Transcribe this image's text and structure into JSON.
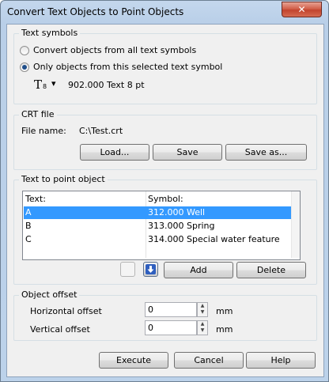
{
  "window": {
    "title": "Convert Text Objects to Point Objects",
    "close_glyph": "✕"
  },
  "text_symbols": {
    "group_label": "Text symbols",
    "option_all": "Convert objects from all text symbols",
    "option_selected": "Only objects from this selected text symbol",
    "selected_option": "option_selected",
    "symbol_icon": "T",
    "symbol_icon_sub": "8",
    "symbol_dropdown_arrow": "▾",
    "symbol_name": "902.000 Text 8 pt"
  },
  "crt_file": {
    "group_label": "CRT file",
    "file_name_label": "File name:",
    "file_name_value": "C:\\Test.crt",
    "load_button": "Load...",
    "save_button": "Save",
    "save_as_button": "Save as..."
  },
  "text_to_point": {
    "group_label": "Text to point object",
    "columns": {
      "text": "Text:",
      "symbol": "Symbol:"
    },
    "rows": [
      {
        "text": "A",
        "symbol": "312.000 Well",
        "selected": true
      },
      {
        "text": "B",
        "symbol": "313.000 Spring",
        "selected": false
      },
      {
        "text": "C",
        "symbol": "314.000 Special water feature",
        "selected": false
      }
    ],
    "add_button": "Add",
    "delete_button": "Delete",
    "move_down_icon": "arrow-down-icon"
  },
  "object_offset": {
    "group_label": "Object offset",
    "horizontal_label": "Horizontal offset",
    "horizontal_value": "0",
    "vertical_label": "Vertical offset",
    "vertical_value": "0",
    "unit": "mm"
  },
  "footer": {
    "execute_button": "Execute",
    "cancel_button": "Cancel",
    "help_button": "Help"
  },
  "colors": {
    "selection": "#3399ff",
    "title_bar": "#bcd2ea",
    "close_button": "#c2442e"
  }
}
